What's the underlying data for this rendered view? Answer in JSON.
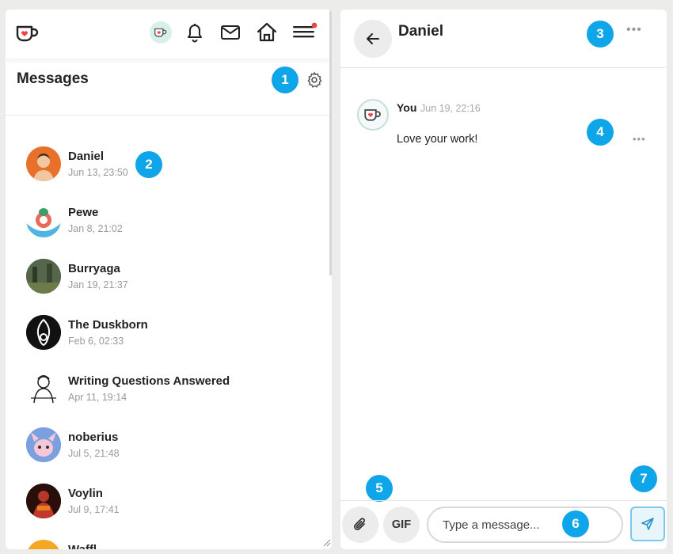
{
  "left_panel": {
    "title": "Messages",
    "conversations": [
      {
        "name": "Daniel",
        "date": "Jun 13, 23:50"
      },
      {
        "name": "Pewe",
        "date": "Jan 8, 21:02"
      },
      {
        "name": "Burryaga",
        "date": "Jan 19, 21:37"
      },
      {
        "name": "The Duskborn",
        "date": "Feb 6, 02:33"
      },
      {
        "name": "Writing Questions Answered",
        "date": "Apr 11, 19:14"
      },
      {
        "name": "noberius",
        "date": "Jul 5, 21:48"
      },
      {
        "name": "Voylin",
        "date": "Jul 9, 17:41"
      },
      {
        "name": "Waffl"
      }
    ]
  },
  "chat": {
    "title": "Daniel",
    "messages": [
      {
        "sender": "You",
        "time": "Jun 19, 22:16",
        "text": "Love your work!"
      }
    ],
    "composer": {
      "gif_label": "GIF",
      "placeholder": "Type a message..."
    }
  },
  "annotations": [
    "1",
    "2",
    "3",
    "4",
    "5",
    "6",
    "7"
  ],
  "colors": {
    "accent": "#0ea5e9",
    "notification_dot": "#ef4444",
    "brand_heart": "#ef4444",
    "send_border": "#7cc8ec"
  },
  "icons": [
    "kofi-logo-icon",
    "kofi-avatar-icon",
    "bell-icon",
    "mail-icon",
    "home-icon",
    "menu-icon",
    "gear-icon",
    "back-arrow-icon",
    "more-icon",
    "paperclip-icon",
    "send-icon"
  ]
}
